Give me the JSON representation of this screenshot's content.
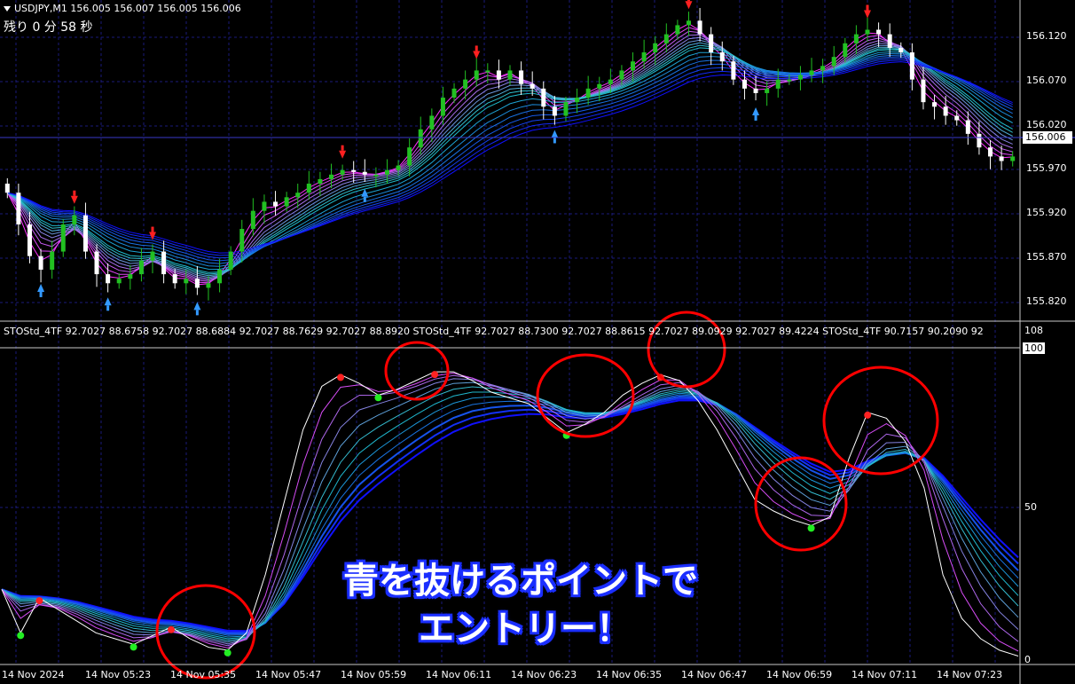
{
  "header": {
    "symbol_label": "USDJPY,M1  156.005 156.007 156.005 156.006",
    "countdown": "残り 0 分 58 秒"
  },
  "price_axis": {
    "ticks": [
      "156.120",
      "156.070",
      "156.020",
      "155.970",
      "155.920",
      "155.870",
      "155.820"
    ],
    "current_price": "156.006"
  },
  "indicator": {
    "header": "STOStd_4TF 92.7027 88.6758 92.7027 88.6884 92.7027 88.7629 92.7027 88.8920  STOStd_4TF 92.7027 88.7300 92.7027 88.8615 92.7027 89.0929 92.7027 89.4224  STOStd_4TF 90.7157 90.2090 92",
    "ticks": [
      "108",
      "100",
      "50",
      "0"
    ]
  },
  "time_axis": {
    "labels": [
      "14 Nov 2024",
      "14 Nov 05:23",
      "14 Nov 05:35",
      "14 Nov 05:47",
      "14 Nov 05:59",
      "14 Nov 06:11",
      "14 Nov 06:23",
      "14 Nov 06:35",
      "14 Nov 06:47",
      "14 Nov 06:59",
      "14 Nov 07:11",
      "14 Nov 07:23"
    ]
  },
  "annotation": {
    "line1": "青を抜けるポイントで",
    "line2": "エントリー！"
  },
  "colors": {
    "background": "#000000",
    "grid": "#1a1a7a",
    "bull_candle": "#22c022",
    "bear_candle": "#ffffff",
    "band_slow": "#1010ff",
    "band_mid": "#20c8c8",
    "band_fast": "#ff30ff",
    "sell_arrow": "#ff2020",
    "buy_arrow": "#3399ff",
    "circle": "#ff0000",
    "callout_outline": "#1a2eff"
  },
  "chart_data": [
    {
      "type": "line",
      "title": "USDJPY,M1",
      "ylabel": "",
      "ylim": [
        155.8,
        156.14
      ],
      "series": [
        {
          "values": [
            155.935,
            155.9,
            155.865,
            155.85,
            155.87,
            155.9,
            155.91,
            155.87,
            155.845,
            155.835,
            155.84,
            155.845,
            155.86,
            155.87,
            155.845,
            155.835,
            155.84,
            155.83,
            155.835,
            155.85,
            155.87,
            155.895,
            155.915,
            155.925,
            155.92,
            155.93,
            155.935,
            155.945,
            155.95,
            155.955,
            155.96,
            155.958,
            155.955,
            155.955,
            155.96,
            155.965,
            155.985,
            156.005,
            156.02,
            156.04,
            156.05,
            156.06,
            156.07,
            156.07,
            156.06,
            156.07,
            156.055,
            156.05,
            156.03,
            156.02,
            156.035,
            156.04,
            156.05,
            156.055,
            156.06,
            156.07,
            156.08,
            156.09,
            156.1,
            156.11,
            156.12,
            156.125,
            156.11,
            156.09,
            156.08,
            156.06,
            156.05,
            156.045,
            156.05,
            156.06,
            156.06,
            156.065,
            156.07,
            156.075,
            156.085,
            156.1,
            156.11,
            156.115,
            156.11,
            156.095,
            156.09,
            156.06,
            156.035,
            156.03,
            156.02,
            156.015,
            156.0,
            155.985,
            155.975,
            155.97,
            155.975
          ]
        }
      ]
    },
    {
      "type": "line",
      "title": "STOStd_4TF",
      "ylabel": "",
      "ylim": [
        0,
        108
      ],
      "series": [
        {
          "values": [
            25,
            10,
            22,
            18,
            14,
            10,
            8,
            6,
            9,
            12,
            8,
            5,
            4,
            10,
            30,
            55,
            80,
            95,
            99,
            96,
            92,
            94,
            97,
            100,
            100,
            97,
            93,
            91,
            89,
            84,
            79,
            82,
            86,
            92,
            96,
            99,
            97,
            90,
            80,
            68,
            56,
            52,
            49,
            47,
            50,
            70,
            86,
            84,
            76,
            60,
            30,
            15,
            8,
            4,
            2
          ]
        }
      ]
    }
  ]
}
